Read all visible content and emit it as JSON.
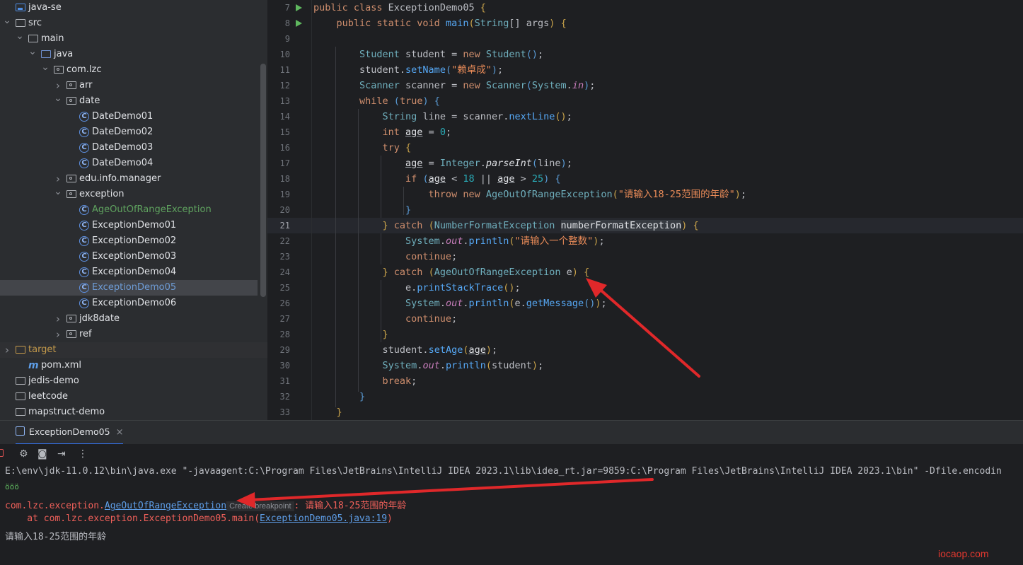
{
  "project_tree": [
    {
      "label": "java-se",
      "depth": 0,
      "arrow": "",
      "icon": "module-folder-icon",
      "kind": "mod"
    },
    {
      "label": "src",
      "depth": 0,
      "arrow": "v",
      "icon": "folder-icon",
      "kind": "folder"
    },
    {
      "label": "main",
      "depth": 1,
      "arrow": "v",
      "icon": "folder-icon",
      "kind": "folder"
    },
    {
      "label": "java",
      "depth": 2,
      "arrow": "v",
      "icon": "source-folder-icon",
      "kind": "src"
    },
    {
      "label": "com.lzc",
      "depth": 3,
      "arrow": "v",
      "icon": "package-icon",
      "kind": "pkg"
    },
    {
      "label": "arr",
      "depth": 4,
      "arrow": ">",
      "icon": "package-icon",
      "kind": "pkg"
    },
    {
      "label": "date",
      "depth": 4,
      "arrow": "v",
      "icon": "package-icon",
      "kind": "pkg"
    },
    {
      "label": "DateDemo01",
      "depth": 5,
      "arrow": "",
      "icon": "class-icon",
      "kind": "class"
    },
    {
      "label": "DateDemo02",
      "depth": 5,
      "arrow": "",
      "icon": "class-icon",
      "kind": "class"
    },
    {
      "label": "DateDemo03",
      "depth": 5,
      "arrow": "",
      "icon": "class-icon",
      "kind": "class"
    },
    {
      "label": "DateDemo04",
      "depth": 5,
      "arrow": "",
      "icon": "class-icon",
      "kind": "class"
    },
    {
      "label": "edu.info.manager",
      "depth": 4,
      "arrow": ">",
      "icon": "package-icon",
      "kind": "pkg"
    },
    {
      "label": "exception",
      "depth": 4,
      "arrow": "v",
      "icon": "package-icon",
      "kind": "pkg"
    },
    {
      "label": "AgeOutOfRangeException",
      "depth": 5,
      "arrow": "",
      "icon": "class-icon",
      "kind": "class",
      "color": "#5fa35f"
    },
    {
      "label": "ExceptionDemo01",
      "depth": 5,
      "arrow": "",
      "icon": "class-icon",
      "kind": "class"
    },
    {
      "label": "ExceptionDemo02",
      "depth": 5,
      "arrow": "",
      "icon": "class-icon",
      "kind": "class"
    },
    {
      "label": "ExceptionDemo03",
      "depth": 5,
      "arrow": "",
      "icon": "class-icon",
      "kind": "class"
    },
    {
      "label": "ExceptionDemo04",
      "depth": 5,
      "arrow": "",
      "icon": "class-icon",
      "kind": "class"
    },
    {
      "label": "ExceptionDemo05",
      "depth": 5,
      "arrow": "",
      "icon": "class-icon",
      "kind": "class",
      "selected": true,
      "color": "#6e9cd6"
    },
    {
      "label": "ExceptionDemo06",
      "depth": 5,
      "arrow": "",
      "icon": "class-icon",
      "kind": "class"
    },
    {
      "label": "jdk8date",
      "depth": 4,
      "arrow": ">",
      "icon": "package-icon",
      "kind": "pkg"
    },
    {
      "label": "ref",
      "depth": 4,
      "arrow": ">",
      "icon": "package-icon",
      "kind": "pkg"
    },
    {
      "label": "target",
      "depth": 0,
      "arrow": ">",
      "icon": "target-folder-icon",
      "kind": "target",
      "color": "#c49a4b",
      "dim": true
    },
    {
      "label": "pom.xml",
      "depth": 1,
      "arrow": "",
      "icon": "maven-icon",
      "kind": "maven"
    },
    {
      "label": "jedis-demo",
      "depth": 0,
      "arrow": "",
      "icon": "folder-icon",
      "kind": "folder"
    },
    {
      "label": "leetcode",
      "depth": 0,
      "arrow": "",
      "icon": "folder-icon",
      "kind": "folder"
    },
    {
      "label": "mapstruct-demo",
      "depth": 0,
      "arrow": "",
      "icon": "folder-icon",
      "kind": "folder"
    }
  ],
  "editor": {
    "line_numbers": [
      "7",
      "8",
      "9",
      "10",
      "11",
      "12",
      "13",
      "14",
      "15",
      "16",
      "17",
      "18",
      "19",
      "20",
      "21",
      "22",
      "23",
      "24",
      "25",
      "26",
      "27",
      "28",
      "29",
      "30",
      "31",
      "32",
      "33"
    ],
    "current_line": "21",
    "run_markers": [
      "7",
      "8"
    ],
    "lines": [
      [
        [
          "kw",
          "public class "
        ],
        [
          "plain",
          "ExceptionDemo05 "
        ],
        [
          "pa",
          "{"
        ]
      ],
      [
        [
          "kw",
          "    public static void "
        ],
        [
          "fn",
          "main"
        ],
        [
          "pa",
          "("
        ],
        [
          "ty",
          "String"
        ],
        [
          "plain",
          "[] args"
        ],
        [
          "pa",
          ")"
        ],
        [
          "plain",
          " "
        ],
        [
          "pa",
          "{"
        ]
      ],
      [
        [
          "plain",
          ""
        ]
      ],
      [
        [
          "ty",
          "        Student "
        ],
        [
          "plain",
          "student = "
        ],
        [
          "kw",
          "new "
        ],
        [
          "ty",
          "Student"
        ],
        [
          "dp",
          "()"
        ],
        [
          "plain",
          ";"
        ]
      ],
      [
        [
          "plain",
          "        student."
        ],
        [
          "fn",
          "setName"
        ],
        [
          "dp",
          "("
        ],
        [
          "st",
          "\"赖卓成\""
        ],
        [
          "dp",
          ")"
        ],
        [
          "plain",
          ";"
        ]
      ],
      [
        [
          "ty",
          "        Scanner "
        ],
        [
          "plain",
          "scanner = "
        ],
        [
          "kw",
          "new "
        ],
        [
          "ty",
          "Scanner"
        ],
        [
          "dp",
          "("
        ],
        [
          "ty",
          "System"
        ],
        [
          "plain",
          "."
        ],
        [
          "fld",
          "in"
        ],
        [
          "dp",
          ")"
        ],
        [
          "plain",
          ";"
        ]
      ],
      [
        [
          "kw",
          "        while "
        ],
        [
          "dp",
          "("
        ],
        [
          "kw",
          "true"
        ],
        [
          "dp",
          ")"
        ],
        [
          "plain",
          " "
        ],
        [
          "dp",
          "{"
        ]
      ],
      [
        [
          "ty",
          "            String "
        ],
        [
          "plain",
          "line = scanner."
        ],
        [
          "fn",
          "nextLine"
        ],
        [
          "pa",
          "()"
        ],
        [
          "plain",
          ";"
        ]
      ],
      [
        [
          "kw",
          "            int "
        ],
        [
          "ul",
          "age"
        ],
        [
          "plain",
          " = "
        ],
        [
          "nu",
          "0"
        ],
        [
          "plain",
          ";"
        ]
      ],
      [
        [
          "kw",
          "            try "
        ],
        [
          "pa",
          "{"
        ]
      ],
      [
        [
          "plain",
          "                "
        ],
        [
          "ul",
          "age"
        ],
        [
          "plain",
          " = "
        ],
        [
          "ty",
          "Integer"
        ],
        [
          "plain",
          "."
        ],
        [
          "ital",
          "parseInt"
        ],
        [
          "dp",
          "("
        ],
        [
          "plain",
          "line"
        ],
        [
          "dp",
          ")"
        ],
        [
          "plain",
          ";"
        ]
      ],
      [
        [
          "kw",
          "                if "
        ],
        [
          "dp",
          "("
        ],
        [
          "ul",
          "age"
        ],
        [
          "plain",
          " < "
        ],
        [
          "nu",
          "18"
        ],
        [
          "plain",
          " || "
        ],
        [
          "ul",
          "age"
        ],
        [
          "plain",
          " > "
        ],
        [
          "nu",
          "25"
        ],
        [
          "dp",
          ")"
        ],
        [
          "plain",
          " "
        ],
        [
          "dp",
          "{"
        ]
      ],
      [
        [
          "kw",
          "                    throw new "
        ],
        [
          "ty",
          "AgeOutOfRangeException"
        ],
        [
          "pa",
          "("
        ],
        [
          "st",
          "\"请输入18-25范围的年龄\""
        ],
        [
          "pa",
          ")"
        ],
        [
          "plain",
          ";"
        ]
      ],
      [
        [
          "dp",
          "                }"
        ]
      ],
      [
        [
          "pa",
          "            }"
        ],
        [
          "kw",
          " catch "
        ],
        [
          "pa",
          "("
        ],
        [
          "ty",
          "NumberFormatException "
        ],
        [
          "hl",
          "numberFormatException"
        ],
        [
          "pa",
          ")"
        ],
        [
          "plain",
          " "
        ],
        [
          "pa",
          "{"
        ]
      ],
      [
        [
          "ty",
          "                System"
        ],
        [
          "plain",
          "."
        ],
        [
          "fld",
          "out"
        ],
        [
          "plain",
          "."
        ],
        [
          "fn",
          "println"
        ],
        [
          "pa",
          "("
        ],
        [
          "st",
          "\"请输入一个整数\""
        ],
        [
          "pa",
          ")"
        ],
        [
          "plain",
          ";"
        ]
      ],
      [
        [
          "kw",
          "                continue"
        ],
        [
          "plain",
          ";"
        ]
      ],
      [
        [
          "pa",
          "            }"
        ],
        [
          "kw",
          " catch "
        ],
        [
          "pa",
          "("
        ],
        [
          "ty",
          "AgeOutOfRangeException "
        ],
        [
          "plain",
          "e"
        ],
        [
          "pa",
          ")"
        ],
        [
          "plain",
          " "
        ],
        [
          "pa",
          "{"
        ]
      ],
      [
        [
          "plain",
          "                e."
        ],
        [
          "fn",
          "printStackTrace"
        ],
        [
          "pa",
          "()"
        ],
        [
          "plain",
          ";"
        ]
      ],
      [
        [
          "ty",
          "                System"
        ],
        [
          "plain",
          "."
        ],
        [
          "fld",
          "out"
        ],
        [
          "plain",
          "."
        ],
        [
          "fn",
          "println"
        ],
        [
          "pa",
          "("
        ],
        [
          "plain",
          "e."
        ],
        [
          "fn",
          "getMessage"
        ],
        [
          "dp",
          "()"
        ],
        [
          "pa",
          ")"
        ],
        [
          "plain",
          ";"
        ]
      ],
      [
        [
          "kw",
          "                continue"
        ],
        [
          "plain",
          ";"
        ]
      ],
      [
        [
          "pa",
          "            }"
        ]
      ],
      [
        [
          "plain",
          "            student."
        ],
        [
          "fn",
          "setAge"
        ],
        [
          "pa",
          "("
        ],
        [
          "ul",
          "age"
        ],
        [
          "pa",
          ")"
        ],
        [
          "plain",
          ";"
        ]
      ],
      [
        [
          "ty",
          "            System"
        ],
        [
          "plain",
          "."
        ],
        [
          "fld",
          "out"
        ],
        [
          "plain",
          "."
        ],
        [
          "fn",
          "println"
        ],
        [
          "pa",
          "("
        ],
        [
          "plain",
          "student"
        ],
        [
          "pa",
          ")"
        ],
        [
          "plain",
          ";"
        ]
      ],
      [
        [
          "kw",
          "            break"
        ],
        [
          "plain",
          ";"
        ]
      ],
      [
        [
          "dp",
          "        }"
        ]
      ],
      [
        [
          "pa",
          "    }"
        ]
      ]
    ]
  },
  "run_panel": {
    "tab_label": "ExceptionDemo05",
    "tab_close": "×",
    "toolbar": [
      "stop-icon",
      "debug-icon",
      "camera-icon",
      "exit-icon",
      "more-icon"
    ],
    "console": {
      "command": "E:\\env\\jdk-11.0.12\\bin\\java.exe \"-javaagent:C:\\Program Files\\JetBrains\\IntelliJ IDEA 2023.1\\lib\\idea_rt.jar=9859:C:\\Program Files\\JetBrains\\IntelliJ IDEA 2023.1\\bin\" -Dfile.encodin",
      "input_echo": "ööö",
      "exception_prefix": "com.lzc.exception.",
      "exception_class": "AgeOutOfRangeException",
      "breakpoint_hint": "Create breakpoint",
      "exception_message": ": 请输入18-25范围的年龄",
      "at_prefix": "    at com.lzc.exception.ExceptionDemo05.main(",
      "at_link": "ExceptionDemo05.java:19",
      "at_suffix": ")",
      "output_line": "请输入18-25范围的年龄"
    }
  },
  "watermark": "iocaop.com",
  "colors": {
    "accent": "#3574f0",
    "error": "#f0605a",
    "annotation_arrow": "#e0282a"
  }
}
